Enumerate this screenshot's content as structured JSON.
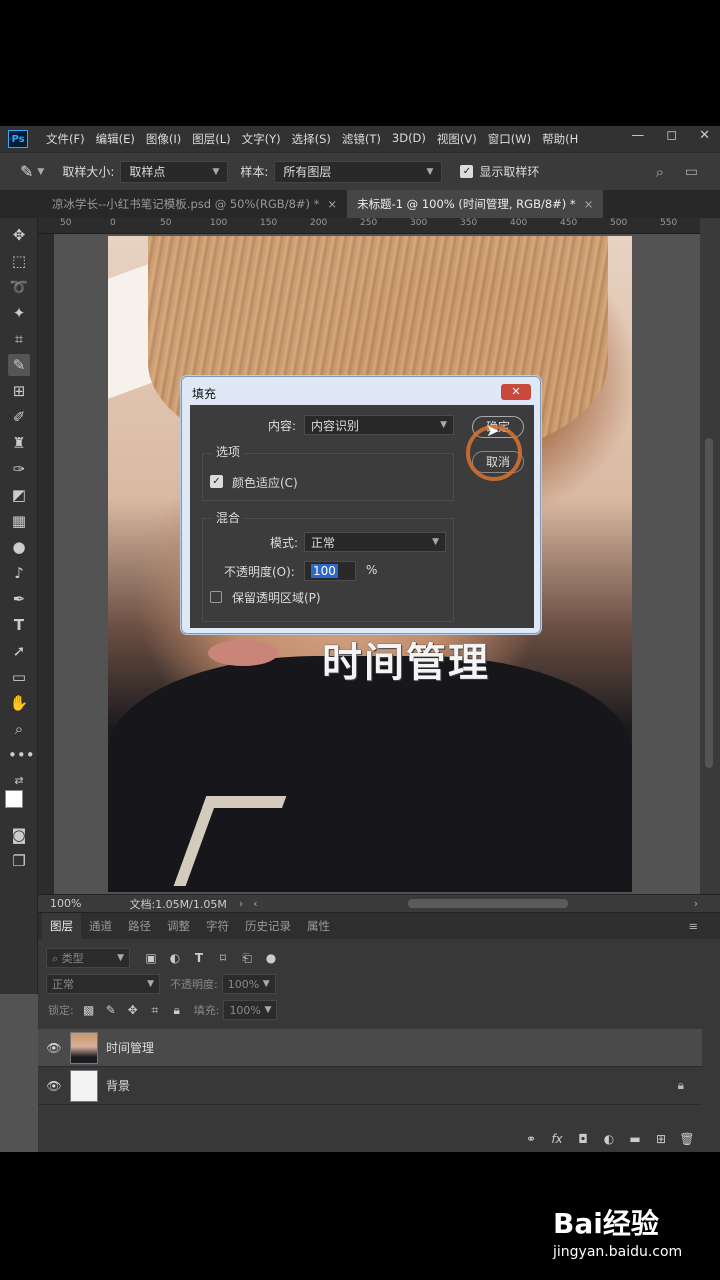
{
  "app": {
    "logo": "Ps",
    "menu": [
      "文件(F)",
      "编辑(E)",
      "图像(I)",
      "图层(L)",
      "文字(Y)",
      "选择(S)",
      "滤镜(T)",
      "3D(D)",
      "视图(V)",
      "窗口(W)",
      "帮助(H"
    ],
    "window_controls": [
      "—",
      "◻",
      "✕"
    ]
  },
  "options_bar": {
    "sample_size_label": "取样大小:",
    "sample_size_value": "取样点",
    "sample_label": "样本:",
    "sample_value": "所有图层",
    "show_ring_label": "显示取样环",
    "show_ring_checked": true
  },
  "tabs": [
    {
      "label": "凉冰学长--小红书笔记模板.psd @ 50%(RGB/8#) *",
      "close": "×"
    },
    {
      "label": "未标题-1 @ 100% (时间管理, RGB/8#) *",
      "close": "×"
    }
  ],
  "ruler": {
    "ticks": [
      "50",
      "0",
      "50",
      "100",
      "150",
      "200",
      "250",
      "300",
      "350",
      "400",
      "450",
      "500",
      "550"
    ]
  },
  "canvas": {
    "text_layer": "时间管理"
  },
  "status": {
    "zoom": "100%",
    "doc": "文档:1.05M/1.05M"
  },
  "dialog": {
    "title": "填充",
    "close": "✕",
    "content_label": "内容:",
    "content_value": "内容识别",
    "ok": "确定",
    "cancel": "取消",
    "options_title": "选项",
    "color_adapt_label": "颜色适应(C)",
    "color_adapt_checked": true,
    "blend_title": "混合",
    "mode_label": "模式:",
    "mode_value": "正常",
    "opacity_label": "不透明度(O):",
    "opacity_value": "100",
    "opacity_unit": "%",
    "preserve_label": "保留透明区域(P)",
    "preserve_checked": false
  },
  "panel": {
    "tabs": [
      "图层",
      "通道",
      "路径",
      "调整",
      "字符",
      "历史记录",
      "属性"
    ],
    "menu_icon": "≡",
    "filter_label": "类型",
    "blend_value": "正常",
    "opacity_label": "不透明度:",
    "opacity_value": "100%",
    "lock_label": "锁定:",
    "fill_label": "填充:",
    "fill_value": "100%",
    "layers": [
      {
        "name": "时间管理",
        "visible": true,
        "active": true,
        "locked": false
      },
      {
        "name": "背景",
        "visible": true,
        "active": false,
        "locked": true
      }
    ],
    "bottom_icons": [
      "link-icon",
      "fx-icon",
      "mask-icon",
      "adjustment-icon",
      "folder-icon",
      "new-layer-icon",
      "trash-icon"
    ],
    "fx_text": "fx"
  },
  "watermark": {
    "logo": "Bai经验",
    "url": "jingyan.baidu.com"
  }
}
